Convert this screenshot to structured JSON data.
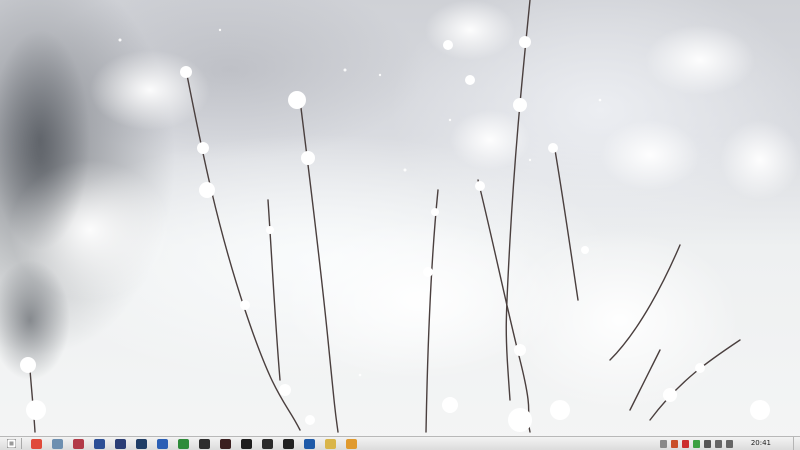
{
  "wallpaper": {
    "subject": "frosted-plants-icon"
  },
  "taskbar": {
    "start_icon": "start-icon",
    "pinned": [
      {
        "name": "chrome-icon",
        "color": "#e04a3a"
      },
      {
        "name": "explorer-icon",
        "color": "#6d8fb0"
      },
      {
        "name": "app-red-blue-icon",
        "color": "#b23a48"
      },
      {
        "name": "app-blue-icon",
        "color": "#2c4f96"
      },
      {
        "name": "app-navy-icon",
        "color": "#2a3d75"
      },
      {
        "name": "photoshop-icon",
        "color": "#1f3d66"
      },
      {
        "name": "word-icon",
        "color": "#2b5fb5"
      },
      {
        "name": "app-green-icon",
        "color": "#2e8b3a"
      },
      {
        "name": "app-cube-icon",
        "color": "#2d2d2d"
      },
      {
        "name": "app-dark-red-icon",
        "color": "#3a1f1f"
      },
      {
        "name": "app-black-icon",
        "color": "#1d1d1d"
      },
      {
        "name": "app-x-icon",
        "color": "#2b2b2b"
      },
      {
        "name": "steam-icon",
        "color": "#222222"
      },
      {
        "name": "app-blue2-icon",
        "color": "#1e5aa8"
      },
      {
        "name": "folder-icon",
        "color": "#d9b54a"
      },
      {
        "name": "media-icon",
        "color": "#e09a2e"
      }
    ],
    "tray_icons": [
      {
        "name": "arrow-icon",
        "color": "#888888"
      },
      {
        "name": "pen-icon",
        "color": "#c9502a"
      },
      {
        "name": "flag-icon",
        "color": "#cc2e2e"
      },
      {
        "name": "battery-icon",
        "color": "#3aa040"
      },
      {
        "name": "monitor-icon",
        "color": "#555555"
      },
      {
        "name": "network-icon",
        "color": "#666666"
      },
      {
        "name": "volume-icon",
        "color": "#666666"
      }
    ],
    "clock": "20:41"
  }
}
